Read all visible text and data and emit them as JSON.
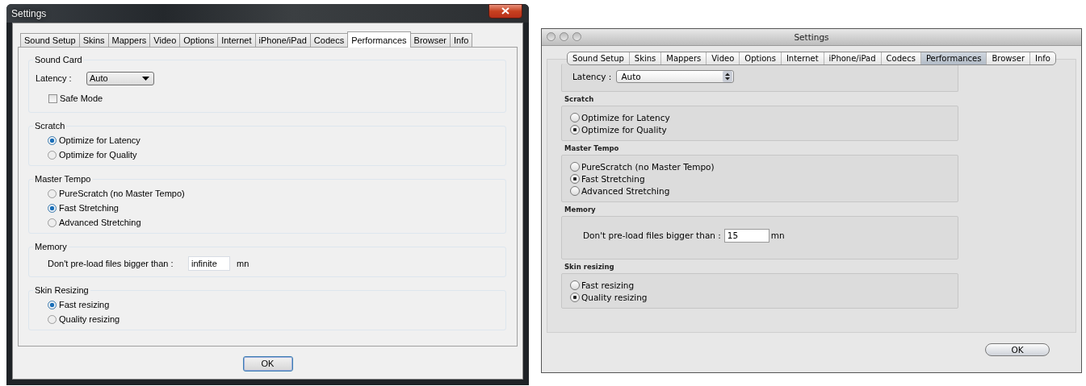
{
  "windows": [
    {
      "kind": "windows",
      "title": "Settings",
      "tabs": [
        {
          "label": "Sound Setup",
          "selected": false
        },
        {
          "label": "Skins",
          "selected": false
        },
        {
          "label": "Mappers",
          "selected": false
        },
        {
          "label": "Video",
          "selected": false
        },
        {
          "label": "Options",
          "selected": false
        },
        {
          "label": "Internet",
          "selected": false
        },
        {
          "label": "iPhone/iPad",
          "selected": false
        },
        {
          "label": "Codecs",
          "selected": false
        },
        {
          "label": "Performances",
          "selected": true
        },
        {
          "label": "Browser",
          "selected": false
        },
        {
          "label": "Info",
          "selected": false
        }
      ],
      "sections": [
        {
          "title": "Sound Card",
          "items": [
            {
              "kind": "dropdown",
              "label": "Latency :",
              "value": "Auto"
            },
            {
              "kind": "checkbox",
              "label": "Safe Mode",
              "checked": false
            }
          ]
        },
        {
          "title": "Scratch",
          "items": [
            {
              "kind": "radio",
              "label": "Optimize for Latency",
              "selected": true
            },
            {
              "kind": "radio",
              "label": "Optimize for Quality",
              "selected": false
            }
          ]
        },
        {
          "title": "Master Tempo",
          "items": [
            {
              "kind": "radio",
              "label": "PureScratch (no Master Tempo)",
              "selected": false
            },
            {
              "kind": "radio",
              "label": "Fast Stretching",
              "selected": true
            },
            {
              "kind": "radio",
              "label": "Advanced Stretching",
              "selected": false
            }
          ]
        },
        {
          "title": "Memory",
          "items": [
            {
              "kind": "field",
              "label": "Don't pre-load files bigger than :",
              "value": "infinite",
              "unit": "mn"
            }
          ]
        },
        {
          "title": "Skin Resizing",
          "items": [
            {
              "kind": "radio",
              "label": "Fast resizing",
              "selected": true
            },
            {
              "kind": "radio",
              "label": "Quality resizing",
              "selected": false
            }
          ]
        }
      ],
      "ok": "OK"
    },
    {
      "kind": "mac",
      "title": "Settings",
      "tabs": [
        {
          "label": "Sound Setup",
          "selected": false
        },
        {
          "label": "Skins",
          "selected": false
        },
        {
          "label": "Mappers",
          "selected": false
        },
        {
          "label": "Video",
          "selected": false
        },
        {
          "label": "Options",
          "selected": false
        },
        {
          "label": "Internet",
          "selected": false
        },
        {
          "label": "iPhone/iPad",
          "selected": false
        },
        {
          "label": "Codecs",
          "selected": false
        },
        {
          "label": "Performances",
          "selected": true
        },
        {
          "label": "Browser",
          "selected": false
        },
        {
          "label": "Info",
          "selected": false
        }
      ],
      "sections": [
        {
          "items": [
            {
              "kind": "dropdown",
              "label": "Latency :",
              "value": "Auto"
            }
          ]
        },
        {
          "title": "Scratch",
          "items": [
            {
              "kind": "radio",
              "label": "Optimize for Latency",
              "selected": false
            },
            {
              "kind": "radio",
              "label": "Optimize for Quality",
              "selected": true
            }
          ]
        },
        {
          "title": "Master Tempo",
          "items": [
            {
              "kind": "radio",
              "label": "PureScratch (no Master Tempo)",
              "selected": false
            },
            {
              "kind": "radio",
              "label": "Fast Stretching",
              "selected": true
            },
            {
              "kind": "radio",
              "label": "Advanced Stretching",
              "selected": false
            }
          ]
        },
        {
          "title": "Memory",
          "items": [
            {
              "kind": "field",
              "label": "Don't pre-load files bigger than :",
              "value": "15",
              "unit": "mn"
            }
          ]
        },
        {
          "title": "Skin resizing",
          "items": [
            {
              "kind": "radio",
              "label": "Fast resizing",
              "selected": false
            },
            {
              "kind": "radio",
              "label": "Quality resizing",
              "selected": true
            }
          ]
        }
      ],
      "ok": "OK"
    }
  ]
}
